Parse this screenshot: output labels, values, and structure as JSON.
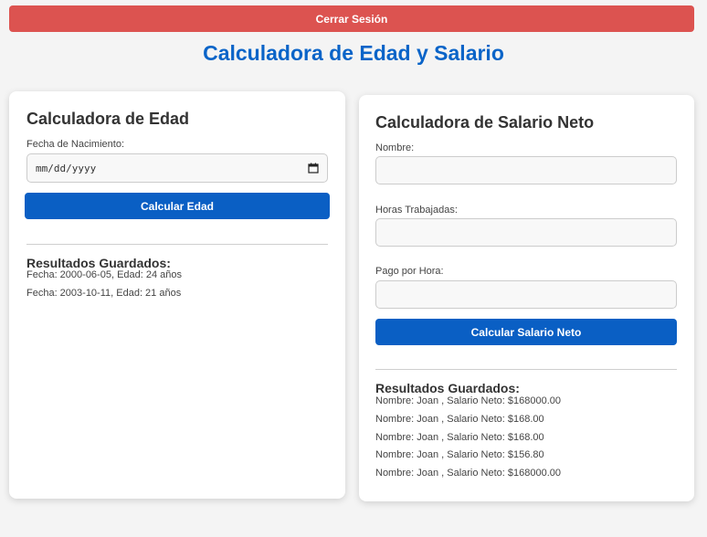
{
  "header": {
    "logout_label": "Cerrar Sesión",
    "title": "Calculadora de Edad y Salario"
  },
  "age_calculator": {
    "title": "Calculadora de Edad",
    "birthdate_label": "Fecha de Nacimiento:",
    "birthdate_placeholder": "mm/dd/yyyy",
    "button_label": "Calcular Edad",
    "results_title": "Resultados Guardados:",
    "results": [
      "Fecha: 2000-06-05, Edad: 24 años",
      "Fecha: 2003-10-11, Edad: 21 años"
    ]
  },
  "salary_calculator": {
    "title": "Calculadora de Salario Neto",
    "name_label": "Nombre:",
    "hours_label": "Horas Trabajadas:",
    "rate_label": "Pago por Hora:",
    "button_label": "Calcular Salario Neto",
    "results_title": "Resultados Guardados:",
    "results": [
      "Nombre: Joan , Salario Neto: $168000.00",
      "Nombre: Joan , Salario Neto: $168.00",
      "Nombre: Joan , Salario Neto: $168.00",
      "Nombre: Joan , Salario Neto: $156.80",
      "Nombre: Joan , Salario Neto: $168000.00"
    ]
  },
  "colors": {
    "logout": "#dc5350",
    "title": "#0a64c8",
    "button": "#0a5fc4"
  },
  "icons": {
    "date_picker": "calendar-icon"
  }
}
